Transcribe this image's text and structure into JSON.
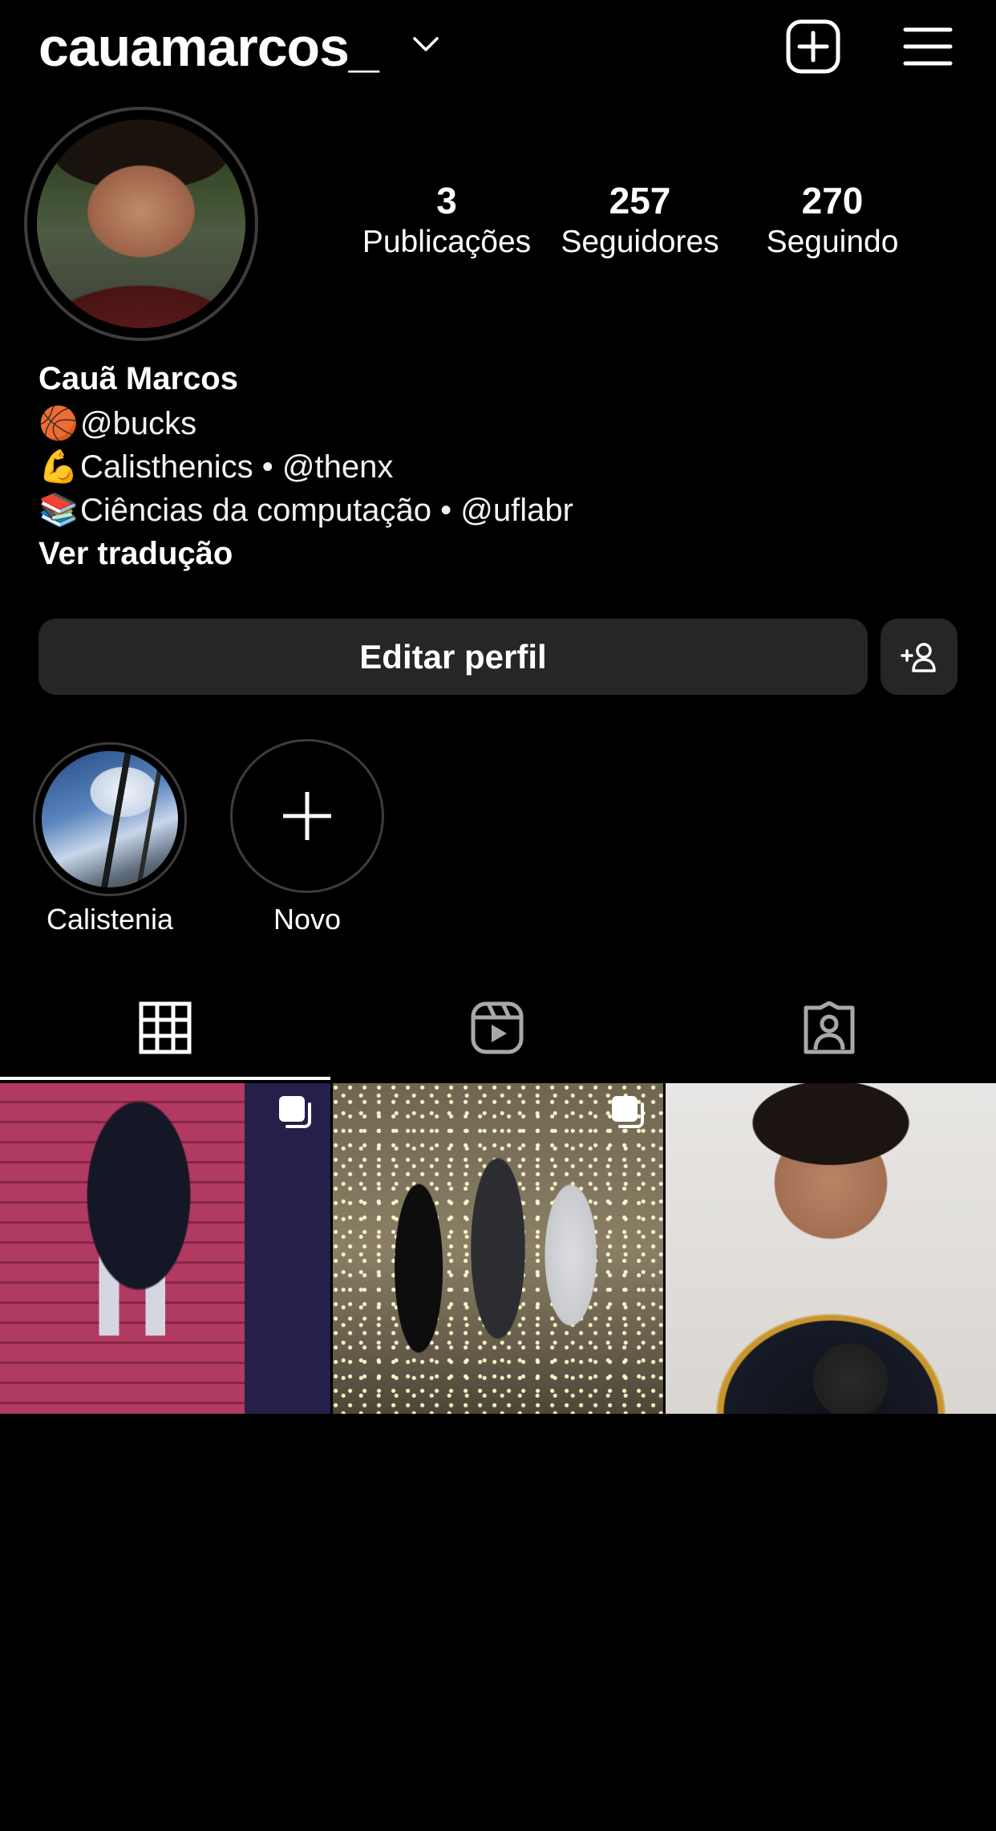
{
  "header": {
    "username": "cauamarcos_"
  },
  "profile": {
    "stats": [
      {
        "value": "3",
        "label": "Publicações"
      },
      {
        "value": "257",
        "label": "Seguidores"
      },
      {
        "value": "270",
        "label": "Seguindo"
      }
    ],
    "name": "Cauã Marcos",
    "bio": [
      {
        "emoji": "🏀",
        "text": "@bucks"
      },
      {
        "emoji": "💪",
        "text": "Calisthenics • @thenx"
      },
      {
        "emoji": "📚",
        "text": "Ciências da computação • @uflabr"
      }
    ],
    "translate_label": "Ver tradução"
  },
  "actions": {
    "edit_label": "Editar perfil"
  },
  "highlights": [
    {
      "label": "Calistenia"
    },
    {
      "label": "Novo"
    }
  ],
  "tabs": [
    {
      "icon": "grid-icon",
      "active": true
    },
    {
      "icon": "reels-icon",
      "active": false
    },
    {
      "icon": "tagged-icon",
      "active": false
    }
  ],
  "posts": [
    {
      "multi": true
    },
    {
      "multi": true
    },
    {
      "multi": false
    }
  ]
}
